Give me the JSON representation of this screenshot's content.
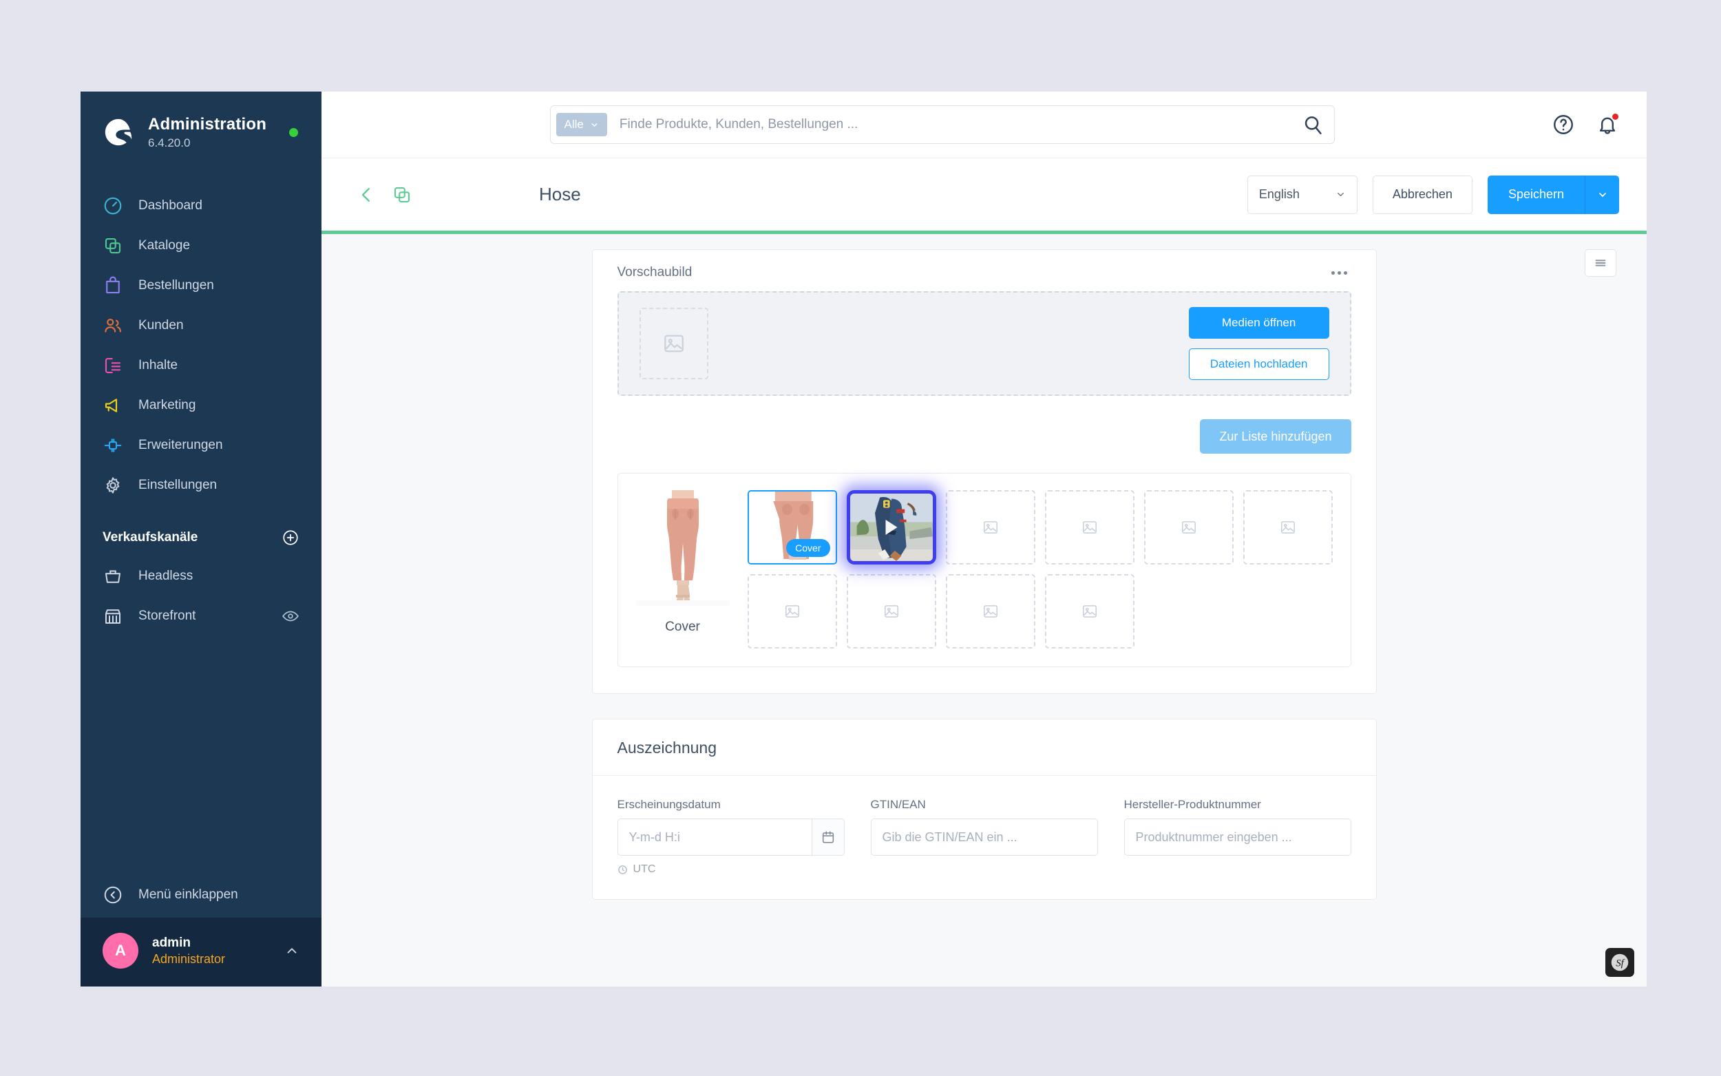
{
  "sidebar": {
    "brand": {
      "title": "Administration",
      "version": "6.4.20.0"
    },
    "nav": [
      {
        "label": "Dashboard",
        "icon": "dashboard-icon",
        "color": "#38b6d4"
      },
      {
        "label": "Kataloge",
        "icon": "catalog-icon",
        "color": "#4ec98d"
      },
      {
        "label": "Bestellungen",
        "icon": "orders-icon",
        "color": "#8f7ef0"
      },
      {
        "label": "Kunden",
        "icon": "customers-icon",
        "color": "#e0703c"
      },
      {
        "label": "Inhalte",
        "icon": "content-icon",
        "color": "#ee4fb0"
      },
      {
        "label": "Marketing",
        "icon": "marketing-icon",
        "color": "#edd21a"
      },
      {
        "label": "Erweiterungen",
        "icon": "extensions-icon",
        "color": "#2aa7f0"
      },
      {
        "label": "Einstellungen",
        "icon": "settings-icon",
        "color": "#c2cbd8"
      }
    ],
    "sales_channels": {
      "title": "Verkaufskanäle",
      "items": [
        {
          "label": "Headless",
          "icon": "basket-icon",
          "has_eye": false
        },
        {
          "label": "Storefront",
          "icon": "store-icon",
          "has_eye": true
        }
      ]
    },
    "collapse_label": "Menü einklappen",
    "user": {
      "initial": "A",
      "name": "admin",
      "role": "Administrator"
    }
  },
  "topbar": {
    "search": {
      "scope_label": "Alle",
      "placeholder": "Finde Produkte, Kunden, Bestellungen ...",
      "value": ""
    },
    "help_icon": "help-icon",
    "notification_icon": "bell-icon"
  },
  "pagehead": {
    "title": "Hose",
    "back_icon": "chevron-left-icon",
    "duplicate_icon": "duplicate-icon",
    "language": "English",
    "cancel_label": "Abbrechen",
    "save_label": "Speichern"
  },
  "content": {
    "toggle_icon": "list-toggle-icon",
    "preview": {
      "label": "Vorschaubild",
      "open_media_label": "Medien öffnen",
      "upload_label": "Dateien hochladen",
      "menu_icon": "more-options-icon"
    },
    "add_to_list_label": "Zur Liste hinzufügen",
    "media": {
      "cover_caption": "Cover",
      "cover_badge_label": "Cover",
      "filled_count": 2,
      "empty_slots_row1": 4,
      "empty_slots_row2": 4
    },
    "marking": {
      "section_title": "Auszeichnung",
      "fields": [
        {
          "label": "Erscheinungsdatum",
          "placeholder": "Y-m-d H:i",
          "value": "",
          "hint": "UTC"
        },
        {
          "label": "GTIN/EAN",
          "placeholder": "Gib die GTIN/EAN ein ...",
          "value": ""
        },
        {
          "label": "Hersteller-Produktnummer",
          "placeholder": "Produktnummer eingeben ...",
          "value": ""
        }
      ]
    }
  },
  "symfony_badge": "symfony-profiler-icon"
}
